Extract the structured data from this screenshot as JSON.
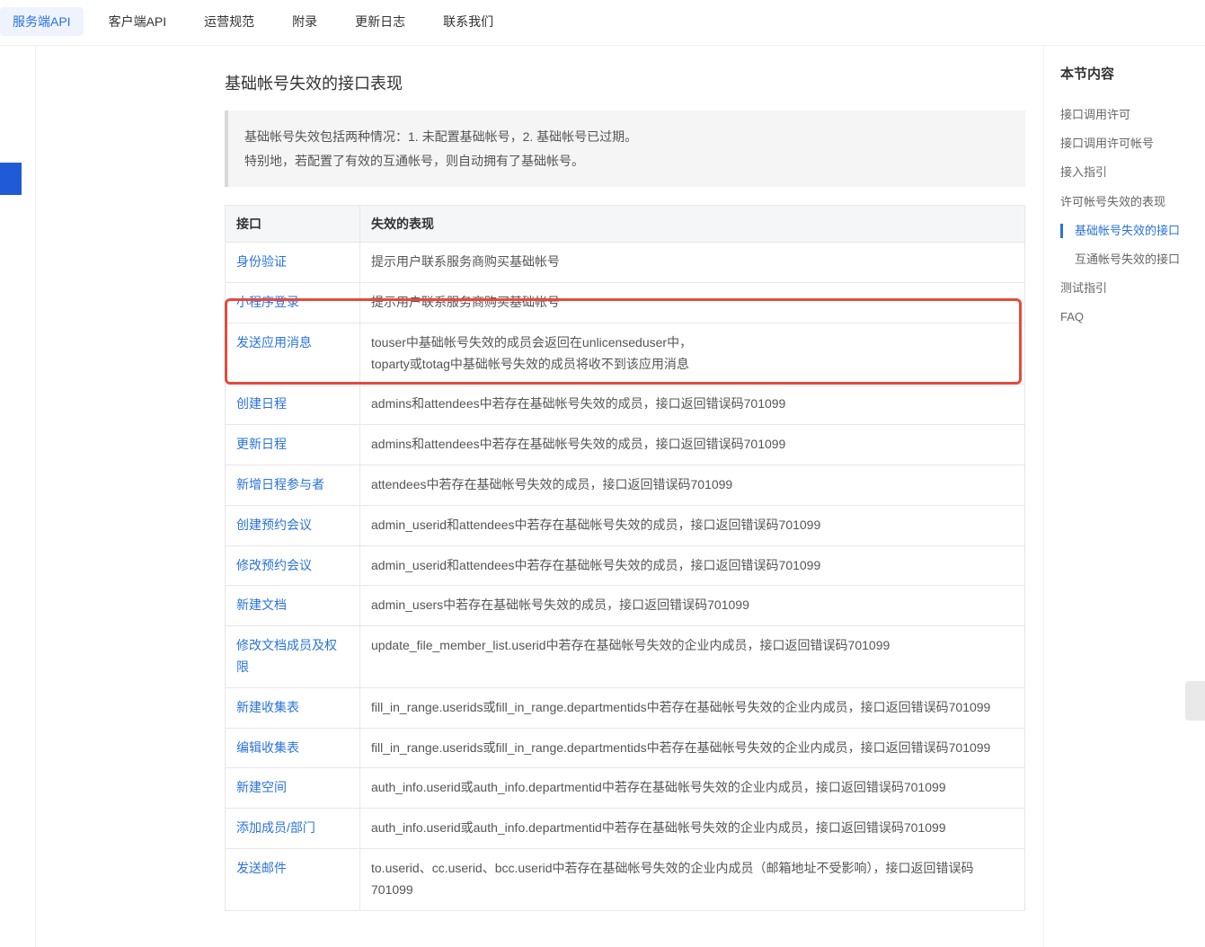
{
  "topnav": {
    "tabs": [
      {
        "label": "服务端API",
        "active": true
      },
      {
        "label": "客户端API",
        "active": false
      },
      {
        "label": "运营规范",
        "active": false
      },
      {
        "label": "附录",
        "active": false
      },
      {
        "label": "更新日志",
        "active": false
      },
      {
        "label": "联系我们",
        "active": false
      }
    ]
  },
  "main": {
    "heading": "基础帐号失效的接口表现",
    "callout_line1": "基础帐号失效包括两种情况：1. 未配置基础帐号，2. 基础帐号已过期。",
    "callout_line2": "特别地，若配置了有效的互通帐号，则自动拥有了基础帐号。",
    "table": {
      "col1": "接口",
      "col2": "失效的表现",
      "rows": [
        {
          "api": "身份验证",
          "desc": "提示用户联系服务商购买基础帐号"
        },
        {
          "api": "小程序登录",
          "desc": "提示用户联系服务商购买基础帐号"
        },
        {
          "api": "发送应用消息",
          "desc": "touser中基础帐号失效的成员会返回在unlicenseduser中，\ntoparty或totag中基础帐号失效的成员将收不到该应用消息",
          "highlight": true
        },
        {
          "api": "创建日程",
          "desc": "admins和attendees中若存在基础帐号失效的成员，接口返回错误码701099"
        },
        {
          "api": "更新日程",
          "desc": "admins和attendees中若存在基础帐号失效的成员，接口返回错误码701099"
        },
        {
          "api": "新增日程参与者",
          "desc": "attendees中若存在基础帐号失效的成员，接口返回错误码701099"
        },
        {
          "api": "创建预约会议",
          "desc": "admin_userid和attendees中若存在基础帐号失效的成员，接口返回错误码701099"
        },
        {
          "api": "修改预约会议",
          "desc": "admin_userid和attendees中若存在基础帐号失效的成员，接口返回错误码701099"
        },
        {
          "api": "新建文档",
          "desc": "admin_users中若存在基础帐号失效的成员，接口返回错误码701099"
        },
        {
          "api": "修改文档成员及权限",
          "desc": "update_file_member_list.userid中若存在基础帐号失效的企业内成员，接口返回错误码701099"
        },
        {
          "api": "新建收集表",
          "desc": "fill_in_range.userids或fill_in_range.departmentids中若存在基础帐号失效的企业内成员，接口返回错误码701099"
        },
        {
          "api": "编辑收集表",
          "desc": "fill_in_range.userids或fill_in_range.departmentids中若存在基础帐号失效的企业内成员，接口返回错误码701099"
        },
        {
          "api": "新建空间",
          "desc": "auth_info.userid或auth_info.departmentid中若存在基础帐号失效的企业内成员，接口返回错误码701099"
        },
        {
          "api": "添加成员/部门",
          "desc": "auth_info.userid或auth_info.departmentid中若存在基础帐号失效的企业内成员，接口返回错误码701099"
        },
        {
          "api": "发送邮件",
          "desc": "to.userid、cc.userid、bcc.userid中若存在基础帐号失效的企业内成员（邮箱地址不受影响），接口返回错误码701099"
        }
      ]
    }
  },
  "right": {
    "title": "本节内容",
    "items": [
      {
        "label": "接口调用许可",
        "sub": false,
        "active": false
      },
      {
        "label": "接口调用许可帐号",
        "sub": false,
        "active": false
      },
      {
        "label": "接入指引",
        "sub": false,
        "active": false
      },
      {
        "label": "许可帐号失效的表现",
        "sub": false,
        "active": false
      },
      {
        "label": "基础帐号失效的接口",
        "sub": true,
        "active": true
      },
      {
        "label": "互通帐号失效的接口",
        "sub": true,
        "active": false
      },
      {
        "label": "测试指引",
        "sub": false,
        "active": false
      },
      {
        "label": "FAQ",
        "sub": false,
        "active": false
      }
    ]
  }
}
